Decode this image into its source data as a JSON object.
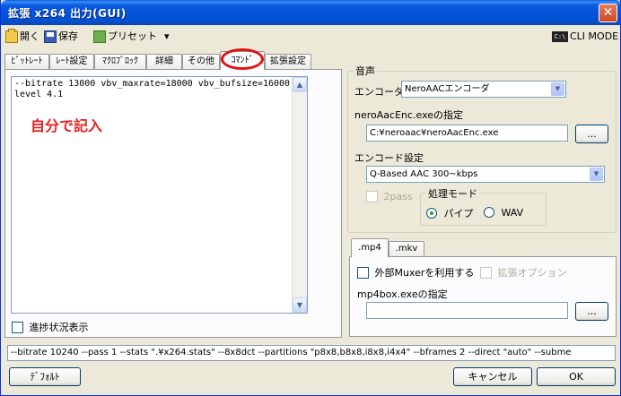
{
  "window": {
    "title": "拡張 x264 出力(GUI)"
  },
  "toolbar": {
    "open": "開く",
    "save": "保存",
    "preset": "プリセット",
    "preset_arrow": "▾",
    "cli_mode": "CLI MODE",
    "cli_icon_text": "C:\\"
  },
  "tabs": [
    {
      "label": "ﾋﾞｯﾄﾚｰﾄ"
    },
    {
      "label": "ﾚｰﾄ設定"
    },
    {
      "label": "ﾏｸﾛﾌﾞﾛｯｸ"
    },
    {
      "label": "詳細"
    },
    {
      "label": "その他"
    },
    {
      "label": "ｺﾏﾝﾄﾞ"
    },
    {
      "label": "拡張設定"
    }
  ],
  "command": {
    "text": "--bitrate 13000 vbv_maxrate=18000 vbv_bufsize=16000 --level 4.1",
    "annotation": "自分で記入",
    "progress_checkbox": "進捗状況表示"
  },
  "audio": {
    "group_title": "音声",
    "encoder_label": "エンコーダ",
    "encoder_value": "NeroAACエンコーダ",
    "exe_label": "neroAacEnc.exeの指定",
    "exe_path": "C:¥neroaac¥neroAacEnc.exe",
    "browse": "...",
    "enc_setting_label": "エンコード設定",
    "enc_setting_value": "Q-Based AAC 300~kbps",
    "twopass": "2pass",
    "mode_title": "処理モード",
    "mode_pipe": "パイプ",
    "mode_wav": "WAV"
  },
  "mux": {
    "tabs": [
      {
        "label": ".mp4"
      },
      {
        "label": ".mkv"
      }
    ],
    "external_muxer": "外部Muxerを利用する",
    "ext_option": "拡張オプション",
    "mp4box_label": "mp4box.exeの指定",
    "mp4box_path": "",
    "browse": "..."
  },
  "cmdline": "--bitrate 10240 --pass 1 --stats \".¥x264.stats\" --8x8dct --partitions \"p8x8,b8x8,i8x8,i4x4\" --bframes 2 --direct \"auto\" --subme",
  "footer": {
    "default": "ﾃﾞﾌｫﾙﾄ",
    "cancel": "キャンセル",
    "ok": "OK"
  }
}
